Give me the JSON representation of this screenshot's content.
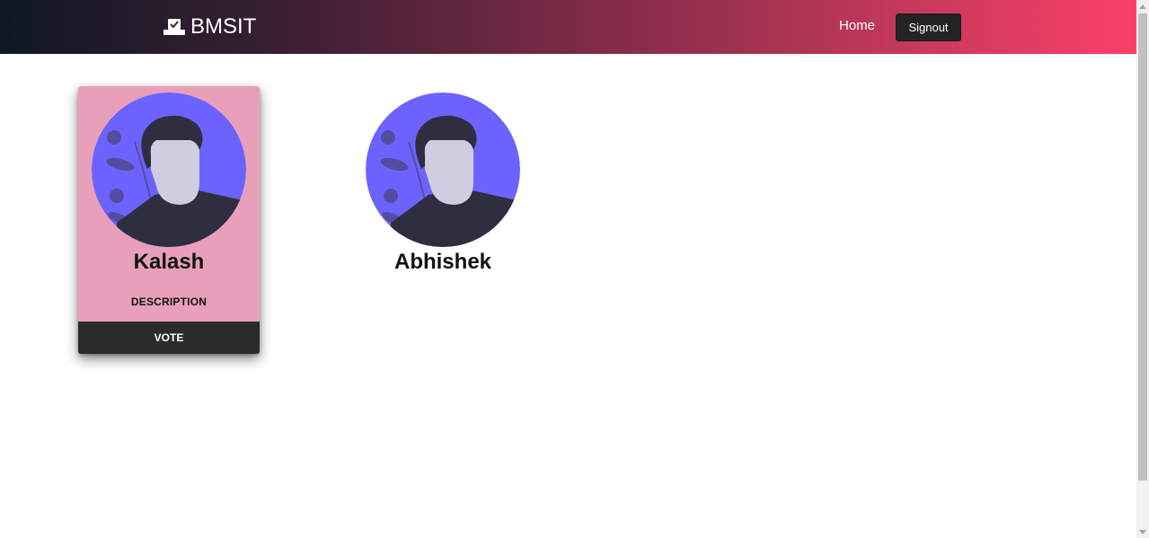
{
  "navbar": {
    "brand_icon": "ballot-box-check-icon",
    "brand_label": "BMSIT",
    "home_label": "Home",
    "signout_label": "Signout",
    "gradient_colors": [
      "#0f1724",
      "#3a1f33",
      "#7a2a45",
      "#c0385a",
      "#fb4068"
    ]
  },
  "candidates": [
    {
      "avatar_icon": "user-avatar-icon",
      "name": "Kalash",
      "description_label": "DESCRIPTION",
      "vote_label": "VOTE",
      "highlighted": true
    },
    {
      "avatar_icon": "user-avatar-icon",
      "name": "Abhishek",
      "highlighted": false
    }
  ],
  "colors": {
    "card_background": "#e8a0ba",
    "vote_button": "#2b2b2b",
    "avatar_background": "#6c63ff",
    "avatar_hair": "#2f2e41",
    "avatar_skin": "#d0cde1"
  }
}
